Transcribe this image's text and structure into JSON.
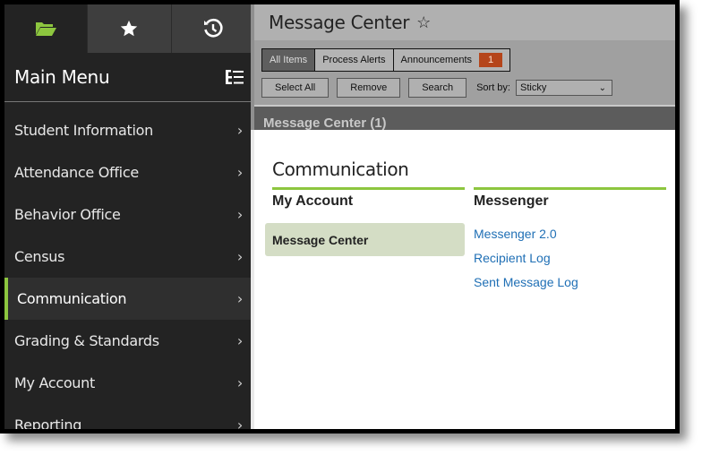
{
  "sidebar": {
    "tabs": [
      {
        "icon": "folder-open-icon",
        "label": "Menu",
        "active": true
      },
      {
        "icon": "star-icon",
        "label": "Favorites",
        "active": false
      },
      {
        "icon": "history-icon",
        "label": "Recent",
        "active": false
      }
    ],
    "title": "Main Menu",
    "items": [
      {
        "label": "Student Information",
        "chevron": "›"
      },
      {
        "label": "Attendance Office",
        "chevron": "›"
      },
      {
        "label": "Behavior Office",
        "chevron": "›"
      },
      {
        "label": "Census",
        "chevron": "›"
      },
      {
        "label": "Communication",
        "chevron": "›",
        "active": true
      },
      {
        "label": "Grading & Standards",
        "chevron": "›"
      },
      {
        "label": "My Account",
        "chevron": "›"
      },
      {
        "label": "Reporting",
        "chevron": "›"
      }
    ]
  },
  "header": {
    "title": "Message Center",
    "star": "☆"
  },
  "toolbar": {
    "filter_tabs": [
      {
        "label": "All Items",
        "active": true
      },
      {
        "label": "Process Alerts"
      },
      {
        "label": "Announcements",
        "badge": "1"
      }
    ],
    "select_all": "Select All",
    "remove": "Remove",
    "search": "Search",
    "sort_label": "Sort by:",
    "sort_value": "Sticky",
    "sort_caret": "⌄"
  },
  "section": {
    "title": "Message Center (1)"
  },
  "content": {
    "title": "Communication",
    "columns": [
      {
        "heading": "My Account",
        "items": [
          "Message Center"
        ]
      },
      {
        "heading": "Messenger",
        "items": [
          "Messenger 2.0",
          "Recipient Log",
          "Sent Message Log"
        ]
      }
    ]
  },
  "colors": {
    "accent_green": "#8dc63f",
    "badge_orange": "#b5451b",
    "link_blue": "#1f6fb5",
    "sidebar_bg": "#232323"
  }
}
